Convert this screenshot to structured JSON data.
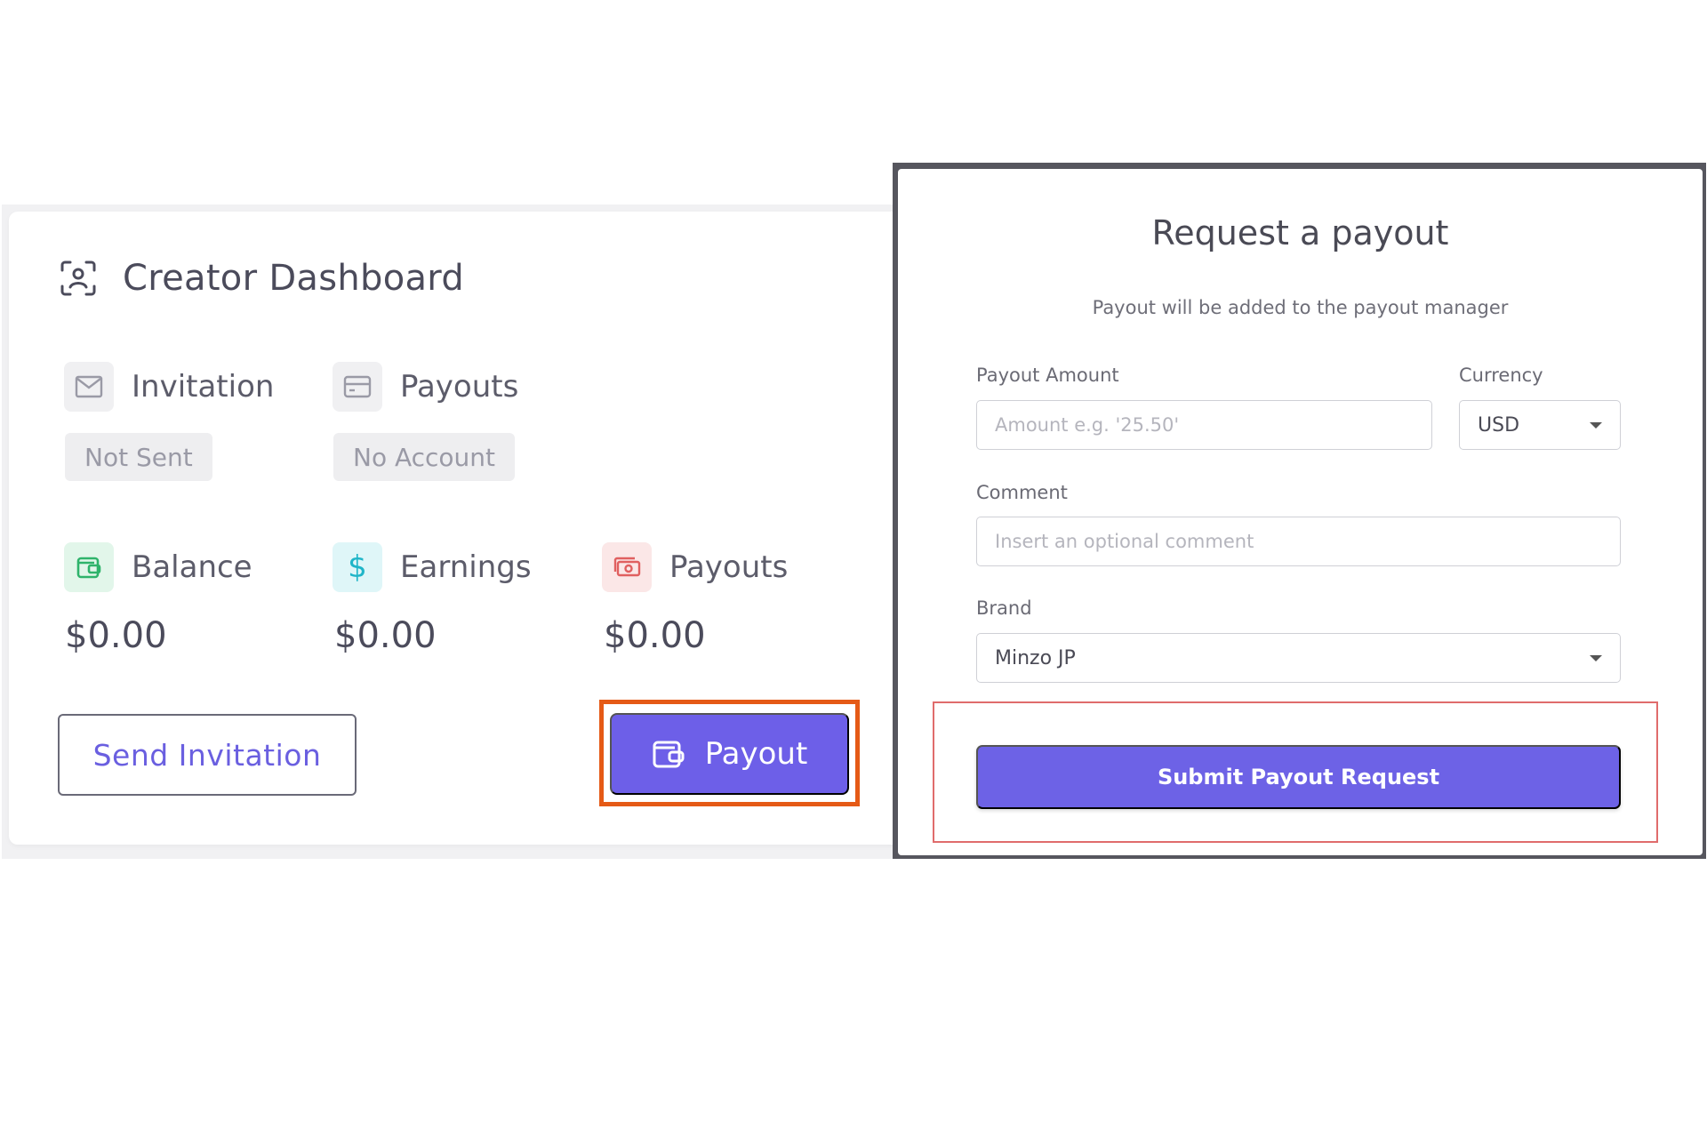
{
  "dashboard": {
    "title": "Creator Dashboard",
    "status": [
      {
        "label": "Invitation",
        "badge": "Not Sent"
      },
      {
        "label": "Payouts",
        "badge": "No Account"
      }
    ],
    "metrics": [
      {
        "label": "Balance",
        "value": "$0.00",
        "color": "#2fb36b"
      },
      {
        "label": "Earnings",
        "value": "$0.00",
        "color": "#1fb5c8"
      },
      {
        "label": "Payouts",
        "value": "$0.00",
        "color": "#e06060"
      }
    ],
    "send_invitation_label": "Send Invitation",
    "payout_label": "Payout"
  },
  "modal": {
    "title": "Request a payout",
    "subtitle": "Payout will be added to the payout manager",
    "amount_label": "Payout Amount",
    "amount_placeholder": "Amount e.g. '25.50'",
    "currency_label": "Currency",
    "currency_value": "USD",
    "comment_label": "Comment",
    "comment_placeholder": "Insert an optional comment",
    "brand_label": "Brand",
    "brand_value": "Minzo JP",
    "submit_label": "Submit Payout Request"
  },
  "colors": {
    "accent": "#6d5fe8",
    "highlight_orange": "#e55a16",
    "highlight_red": "#e06c6c"
  }
}
